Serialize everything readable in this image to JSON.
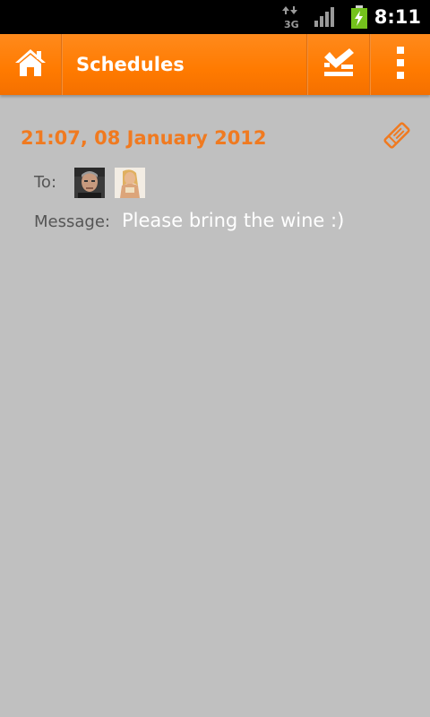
{
  "status_bar": {
    "network_type": "3G",
    "time": "8:11",
    "icons": {
      "network": "3g-data-icon",
      "signal": "signal-strength-icon",
      "battery": "battery-charging-icon"
    }
  },
  "action_bar": {
    "title": "Schedules",
    "icons": {
      "home": "home-icon",
      "done": "checklist-icon",
      "menu": "overflow-menu-icon"
    },
    "accent_color": "#ff7a00"
  },
  "schedule": {
    "date": "21:07, 08 January 2012",
    "edit_icon": "edit-pencil-icon",
    "to_label": "To:",
    "recipients": [
      {
        "avatar_icon": "contact-avatar-1"
      },
      {
        "avatar_icon": "contact-avatar-2"
      }
    ],
    "message_label": "Message:",
    "message": "Please bring the wine :)",
    "date_color": "#f07a20"
  },
  "colors": {
    "background": "#c0c0c0",
    "status_bar": "#000000"
  }
}
